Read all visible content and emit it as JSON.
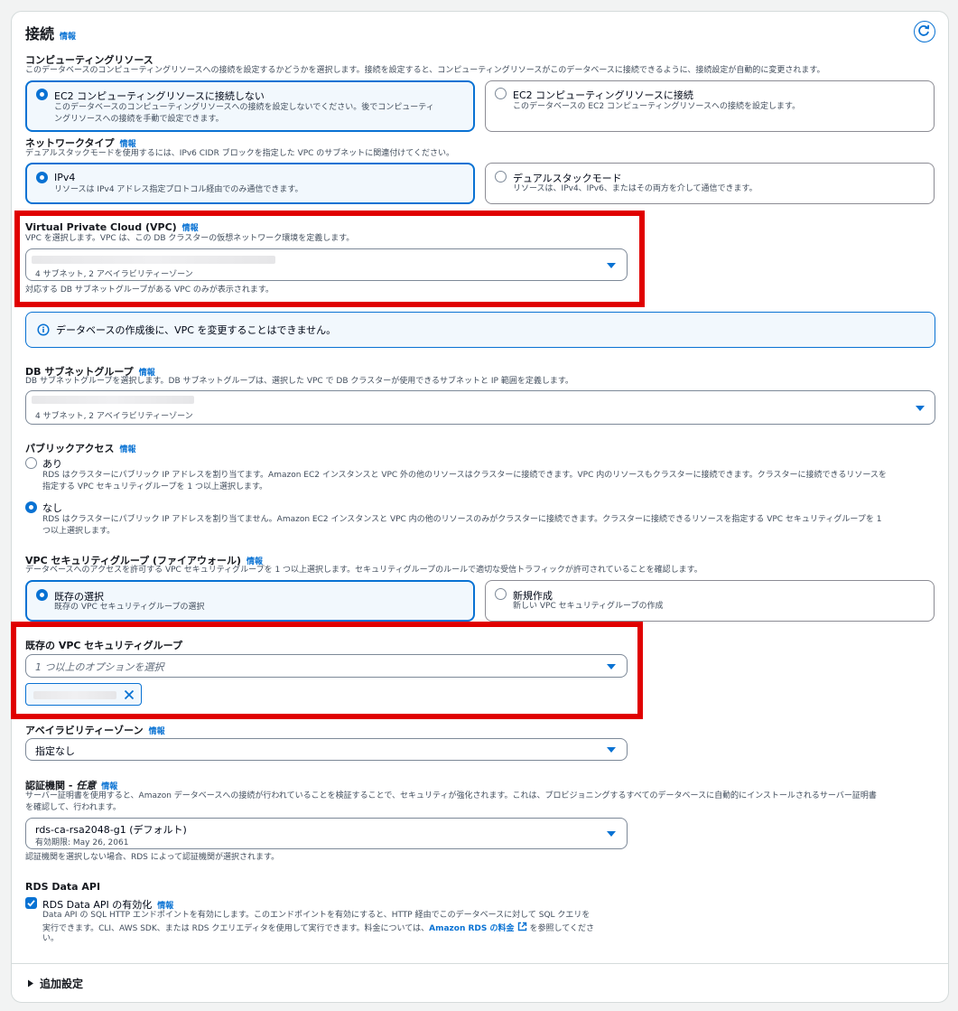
{
  "header": {
    "title": "接続",
    "info": "情報"
  },
  "compute": {
    "title": "コンピューティングリソース",
    "desc": "このデータベースのコンピューティングリソースへの接続を設定するかどうかを選択します。接続を設定すると、コンピューティングリソースがこのデータベースに接続できるように、接続設定が自動的に変更されます。",
    "opt1_label": "EC2 コンピューティングリソースに接続しない",
    "opt1_desc1": "このデータベースのコンピューティングリソースへの接続を設定しないでください。後でコンピューティ",
    "opt1_desc2": "ングリソースへの接続を手動で設定できます。",
    "opt2_label": "EC2 コンピューティングリソースに接続",
    "opt2_desc": "このデータベースの EC2 コンピューティングリソースへの接続を設定します。"
  },
  "network": {
    "title": "ネットワークタイプ",
    "info": "情報",
    "desc": "デュアルスタックモードを使用するには、IPv6 CIDR ブロックを指定した VPC のサブネットに関連付けてください。",
    "opt1_label": "IPv4",
    "opt1_desc": "リソースは IPv4 アドレス指定プロトコル経由でのみ通信できます。",
    "opt2_label": "デュアルスタックモード",
    "opt2_desc": "リソースは、IPv4、IPv6、またはその両方を介して通信できます。"
  },
  "vpc": {
    "title": "Virtual Private Cloud (VPC)",
    "info": "情報",
    "desc": "VPC を選択します。VPC は、この DB クラスターの仮想ネットワーク環境を定義します。",
    "sub": "4 サブネット, 2 アベイラビリティーゾーン",
    "hint": "対応する DB サブネットグループがある VPC のみが表示されます。"
  },
  "alert": {
    "text": "データベースの作成後に、VPC を変更することはできません。"
  },
  "subnet": {
    "title": "DB サブネットグループ",
    "info": "情報",
    "desc": "DB サブネットグループを選択します。DB サブネットグループは、選択した VPC で DB クラスターが使用できるサブネットと IP 範囲を定義します。",
    "sub": "4 サブネット, 2 アベイラビリティーゾーン"
  },
  "public": {
    "title": "パブリックアクセス",
    "info": "情報",
    "yes_label": "あり",
    "yes_desc1": "RDS はクラスターにパブリック IP アドレスを割り当てます。Amazon EC2 インスタンスと VPC 外の他のリソースはクラスターに接続できます。VPC 内のリソースもクラスターに接続できます。クラスターに接続できるリソースを",
    "yes_desc2": "指定する VPC セキュリティグループを 1 つ以上選択します。",
    "no_label": "なし",
    "no_desc1": "RDS はクラスターにパブリック IP アドレスを割り当てません。Amazon EC2 インスタンスと VPC 内の他のリソースのみがクラスターに接続できます。クラスターに接続できるリソースを指定する VPC セキュリティグループを 1",
    "no_desc2": "つ以上選択します。"
  },
  "sg": {
    "title": "VPC セキュリティグループ (ファイアウォール)",
    "info": "情報",
    "desc": "データベースへのアクセスを許可する VPC セキュリティグループを 1 つ以上選択します。セキュリティグループのルールで適切な受信トラフィックが許可されていることを確認します。",
    "opt1_label": "既存の選択",
    "opt1_desc": "既存の VPC セキュリティグループの選択",
    "opt2_label": "新規作成",
    "opt2_desc": "新しい VPC セキュリティグループの作成"
  },
  "existing_sg": {
    "title": "既存の VPC セキュリティグループ",
    "placeholder": "1 つ以上のオプションを選択"
  },
  "az": {
    "title": "アベイラビリティーゾーン",
    "info": "情報",
    "value": "指定なし"
  },
  "ca": {
    "title": "認証機関 - ",
    "title_em": "任意",
    "info": "情報",
    "desc1": "サーバー証明書を使用すると、Amazon データベースへの接続が行われていることを検証することで、セキュリティが強化されます。これは、プロビジョニングするすべてのデータベースに自動的にインストールされるサーバー証明書",
    "desc2": "を確認して、行われます。",
    "value": "rds-ca-rsa2048-g1 (デフォルト)",
    "sub": "有効期限: May 26, 2061",
    "hint": "認証機関を選択しない場合、RDS によって認証機関が選択されます。"
  },
  "dataapi": {
    "title": "RDS Data API",
    "check_label": "RDS Data API の有効化",
    "info": "情報",
    "desc1": "Data API の SQL HTTP エンドポイントを有効にします。このエンドポイントを有効にすると、HTTP 経由でこのデータベースに対して SQL クエリを",
    "desc2a": "実行できます。CLI、AWS SDK、または RDS クエリエディタを使用して実行できます。料金については、",
    "link": "Amazon RDS の料金",
    "desc2b": "を参照してくださ",
    "desc3": "い。"
  },
  "additional": {
    "label": "追加設定"
  },
  "colors": {
    "accent": "#0972d3",
    "highlight": "#e00000"
  }
}
